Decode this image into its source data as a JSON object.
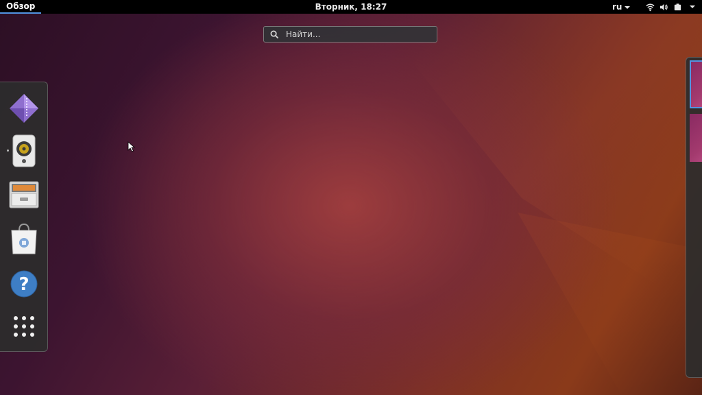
{
  "topbar": {
    "activities_label": "Обзор",
    "clock_label": "Вторник, 18:27",
    "language_label": "ru",
    "system_icons": [
      "wifi-icon",
      "volume-icon",
      "battery-icon",
      "chevron-down-icon"
    ]
  },
  "search": {
    "placeholder": "Найти..."
  },
  "dash": {
    "items": [
      {
        "name": "archive-manager",
        "icon": "archive-manager-icon"
      },
      {
        "name": "rhythmbox",
        "icon": "speaker-icon",
        "running": true
      },
      {
        "name": "files",
        "icon": "file-cabinet-icon"
      },
      {
        "name": "software-center",
        "icon": "shopping-bag-icon"
      },
      {
        "name": "help",
        "icon": "help-icon"
      },
      {
        "name": "show-applications",
        "icon": "app-grid-icon"
      }
    ]
  },
  "workspaces": {
    "count": 2,
    "active_index": 0
  },
  "colors": {
    "accent": "#5294e2",
    "topbar": "#000000",
    "dash_bg": "#2c2c2c",
    "workspace_thumb": "#a33a6e"
  }
}
